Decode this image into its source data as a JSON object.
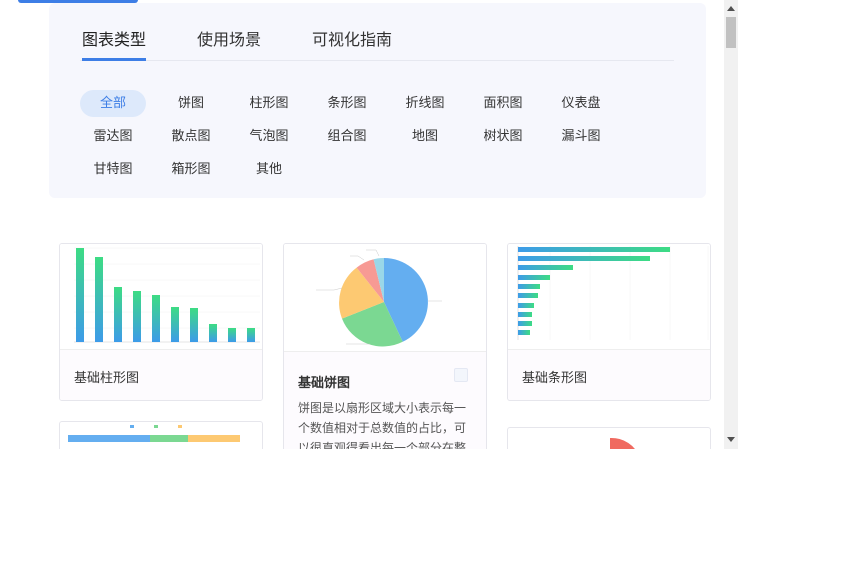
{
  "tabs": [
    {
      "label": "图表类型",
      "active": true
    },
    {
      "label": "使用场景",
      "active": false
    },
    {
      "label": "可视化指南",
      "active": false
    }
  ],
  "tags": [
    {
      "label": "全部",
      "active": true
    },
    {
      "label": "饼图"
    },
    {
      "label": "柱形图"
    },
    {
      "label": "条形图"
    },
    {
      "label": "折线图"
    },
    {
      "label": "面积图"
    },
    {
      "label": "仪表盘"
    },
    {
      "label": "雷达图"
    },
    {
      "label": "散点图"
    },
    {
      "label": "气泡图"
    },
    {
      "label": "组合图"
    },
    {
      "label": "地图"
    },
    {
      "label": "树状图"
    },
    {
      "label": "漏斗图"
    },
    {
      "label": "甘特图"
    },
    {
      "label": "箱形图"
    },
    {
      "label": "其他"
    }
  ],
  "cards": {
    "bar": {
      "title": "基础柱形图"
    },
    "pie": {
      "title": "基础饼图",
      "description": "饼图是以扇形区域大小表示每一个数值相对于总数值的占比，可以很直观得看出每一个部分在整"
    },
    "hbar": {
      "title": "基础条形图"
    }
  },
  "colors": {
    "accent": "#3d7ee6",
    "panel": "#f6f7fd",
    "active_tag_bg": "#dde9fb"
  }
}
